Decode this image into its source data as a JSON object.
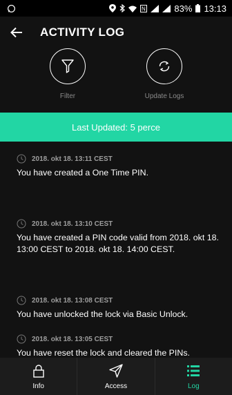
{
  "status_bar": {
    "battery": "83%",
    "time": "13:13"
  },
  "header": {
    "title": "ACTIVITY LOG"
  },
  "actions": {
    "filter_label": "Filter",
    "update_label": "Update Logs"
  },
  "banner": {
    "text": "Last Updated: 5 perce"
  },
  "logs": [
    {
      "time": "2018. okt 18. 13:11 CEST",
      "message": "You have created a One Time PIN."
    },
    {
      "time": "2018. okt 18. 13:10 CEST",
      "message": "You have created a PIN code valid from 2018. okt 18. 13:00 CEST to 2018. okt 18. 14:00 CEST."
    },
    {
      "time": "2018. okt 18. 13:08 CEST",
      "message": "You have unlocked the lock via Basic Unlock."
    },
    {
      "time": "2018. okt 18. 13:05 CEST",
      "message": "You have reset the lock and cleared the PINs."
    }
  ],
  "nav": {
    "info": "Info",
    "access": "Access",
    "log": "Log"
  },
  "colors": {
    "accent": "#22d6a4",
    "background": "#121212",
    "nav_background": "#1c1c1c"
  }
}
